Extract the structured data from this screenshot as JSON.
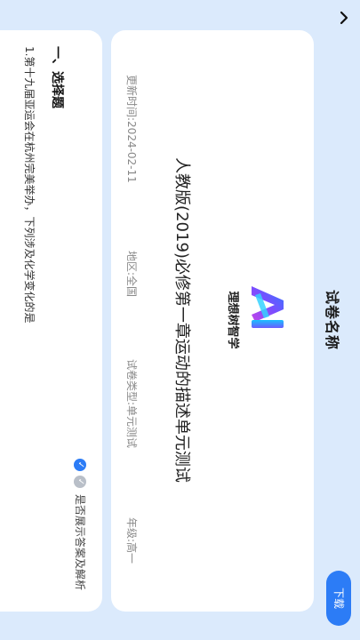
{
  "header": {
    "title": "试卷名称",
    "download_label": "下载"
  },
  "logo": {
    "brand_text": "理想树智学"
  },
  "exam": {
    "title": "人教版(2019)必修第一章运动的描述单元测试",
    "update_time": "更新时间:2024-02-11",
    "region": "地区:全国",
    "type": "试卷类型:单元测试",
    "grade": "年级:高一"
  },
  "questions": {
    "toggle_label": "是否展示答案及解析",
    "section_title": "一、选择题",
    "first_question": "1.第十九届亚运会在杭州完美举办，下列涉及化学变化的是"
  },
  "colors": {
    "background": "#dbeafc",
    "accent": "#2c7cf6",
    "card": "#ffffff"
  },
  "icons": {
    "back": "chevron-up-icon",
    "check_on": "check-circle-icon",
    "check_off": "check-circle-disabled-icon"
  }
}
